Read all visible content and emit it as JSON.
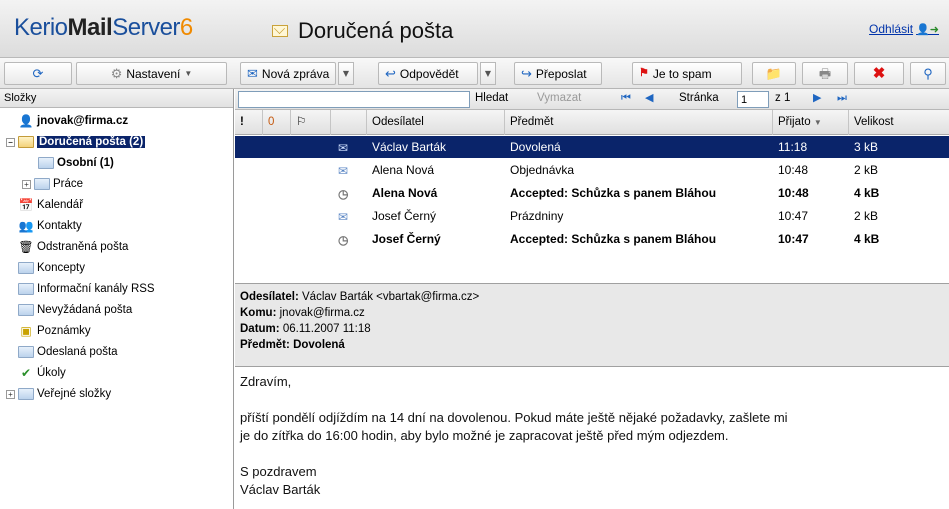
{
  "header": {
    "brand_kerio": "Kerio",
    "brand_mail": "Mail",
    "brand_server": "Server",
    "brand_version": "6",
    "folder_title": "Doručená pošta",
    "logout": "Odhlásit"
  },
  "toolbar": {
    "settings": "Nastavení",
    "new_message": "Nová zpráva",
    "reply": "Odpovědět",
    "forward": "Přeposlat",
    "spam": "Je to spam"
  },
  "sidebar": {
    "header": "Složky",
    "account": "jnovak@firma.cz",
    "inbox": "Doručená pošta (2)",
    "personal": "Osobní (1)",
    "work": "Práce",
    "calendar": "Kalendář",
    "contacts": "Kontakty",
    "deleted": "Odstraněná pošta",
    "drafts": "Koncepty",
    "rss": "Informační kanály RSS",
    "junk": "Nevyžádaná pošta",
    "notes": "Poznámky",
    "sent": "Odeslaná pošta",
    "tasks": "Úkoly",
    "public": "Veřejné složky"
  },
  "search": {
    "value": "",
    "search_btn": "Hledat",
    "clear_btn": "Vymazat",
    "page_label": "Stránka",
    "page_value": "1",
    "page_of": "z 1"
  },
  "columns": {
    "flag": "!",
    "attach": "0",
    "sender": "Odesílatel",
    "subject": "Předmět",
    "received": "Přijato",
    "size": "Velikost"
  },
  "messages": [
    {
      "sender": "Václav Barták",
      "subject": "Dovolená",
      "time": "11:18",
      "size": "3 kB"
    },
    {
      "sender": "Alena Nová",
      "subject": "Objednávka",
      "time": "10:48",
      "size": "2 kB"
    },
    {
      "sender": "Alena Nová",
      "subject": "Accepted: Schůzka s panem Bláhou",
      "time": "10:48",
      "size": "4 kB"
    },
    {
      "sender": "Josef Černý",
      "subject": "Prázdniny",
      "time": "10:47",
      "size": "2 kB"
    },
    {
      "sender": "Josef Černý",
      "subject": "Accepted: Schůzka s panem Bláhou",
      "time": "10:47",
      "size": "4 kB"
    }
  ],
  "preview": {
    "from_label": "Odesílatel:",
    "from_value": "Václav Barták <vbartak@firma.cz>",
    "to_label": "Komu:",
    "to_value": "jnovak@firma.cz",
    "date_label": "Datum:",
    "date_value": "06.11.2007 11:18",
    "subject_label": "Předmět:",
    "subject_value": "Dovolená",
    "greeting": "Zdravím,",
    "body_line1": "příští pondělí odjíždím na 14 dní na dovolenou. Pokud máte ještě nějaké požadavky, zašlete mi",
    "body_line2": "je do zítřka do 16:00 hodin, aby bylo možné je zapracovat ještě před mým odjezdem.",
    "closing": "S pozdravem",
    "signature": "Václav Barták"
  }
}
